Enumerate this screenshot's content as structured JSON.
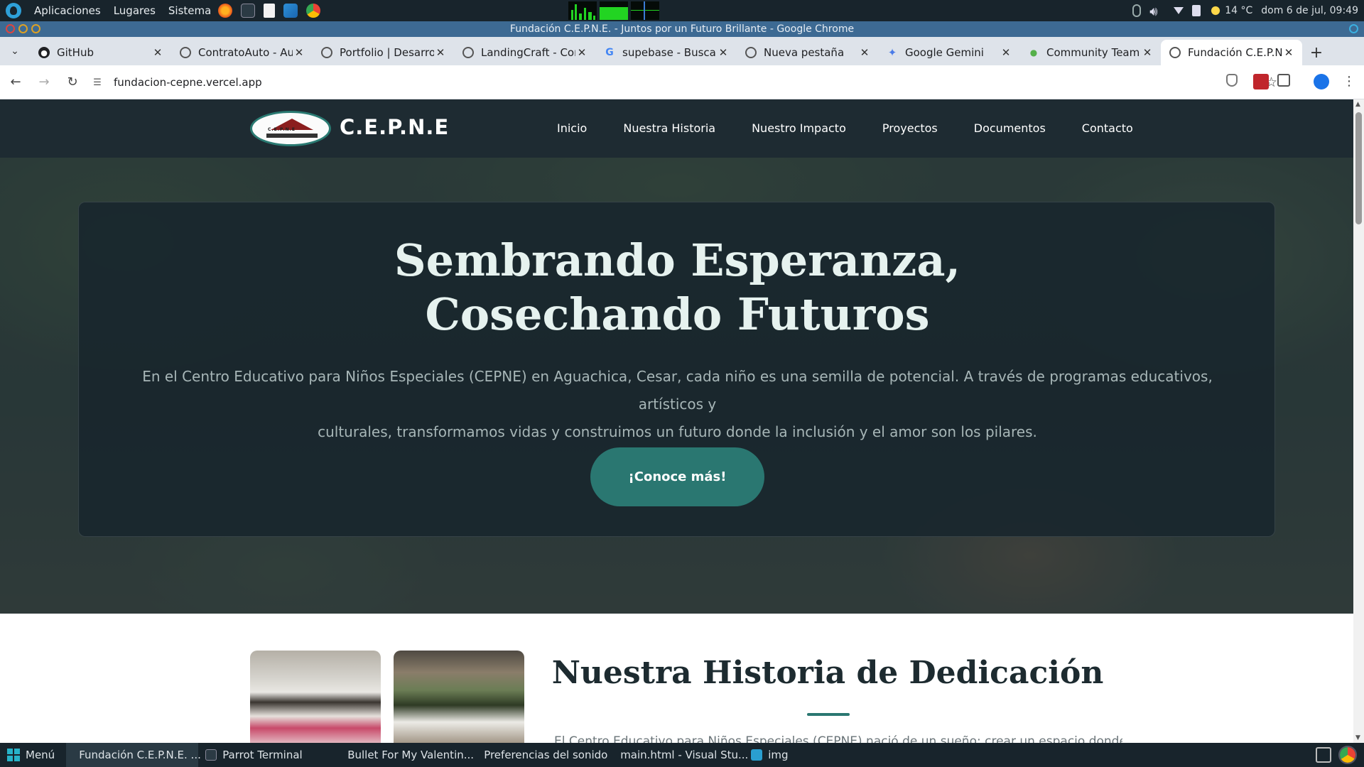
{
  "os_panel": {
    "menu": [
      "Aplicaciones",
      "Lugares",
      "Sistema"
    ],
    "weather": "14 °C",
    "datetime": "dom 6 de jul, 09:49"
  },
  "window": {
    "title": "Fundación C.E.P.N.E. - Juntos por un Futuro Brillante - Google Chrome"
  },
  "tabs": [
    {
      "label": "GitHub",
      "favicon": "github-icon",
      "active": false
    },
    {
      "label": "ContratoAuto - Aut",
      "favicon": "globe-icon",
      "active": false
    },
    {
      "label": "Portfolio | Desarrol",
      "favicon": "globe-icon",
      "active": false
    },
    {
      "label": "LandingCraft - Con",
      "favicon": "globe-icon",
      "active": false
    },
    {
      "label": "supebase - Buscar c",
      "favicon": "google-icon",
      "active": false
    },
    {
      "label": "Nueva pestaña",
      "favicon": "chrome-icon",
      "active": false
    },
    {
      "label": "Google Gemini",
      "favicon": "gemini-icon",
      "active": false
    },
    {
      "label": "Community Team",
      "favicon": "leaf-icon",
      "active": false
    },
    {
      "label": "Fundación C.E.P.N.",
      "favicon": "globe-icon",
      "active": true
    }
  ],
  "address": {
    "url": "fundacion-cepne.vercel.app"
  },
  "site": {
    "brand": "C.E.P.N.E",
    "logo_text": "C.E.P.N.E",
    "nav": [
      "Inicio",
      "Nuestra Historia",
      "Nuestro Impacto",
      "Proyectos",
      "Documentos",
      "Contacto"
    ],
    "hero": {
      "title_line1": "Sembrando Esperanza,",
      "title_line2": "Cosechando Futuros",
      "subtitle_line1": "En el Centro Educativo para Niños Especiales (CEPNE) en Aguachica, Cesar, cada niño es una semilla de potencial. A través de programas educativos, artísticos y",
      "subtitle_line2": "culturales, transformamos vidas y construimos un futuro donde la inclusión y el amor son los pilares.",
      "button": "¡Conoce más!"
    },
    "history": {
      "title": "Nuestra Historia de Dedicación",
      "paragraph": "El Centro Educativo para Niños Especiales (CEPNE) nació de un sueño: crear un espacio donde niños"
    }
  },
  "taskbar": {
    "start": "Menú",
    "items": [
      {
        "label": "Fundación C.E.P.N.E. ...",
        "icon": "chrome-icon"
      },
      {
        "label": "Parrot Terminal",
        "icon": "terminal-icon"
      },
      {
        "label": "Bullet For My Valentin...",
        "icon": "spotify-icon"
      },
      {
        "label": "Preferencias del sonido",
        "icon": "sound-icon"
      },
      {
        "label": "main.html - Visual Stu...",
        "icon": "vscode-icon"
      },
      {
        "label": "img",
        "icon": "folder-icon"
      }
    ]
  },
  "colors": {
    "accent": "#2a7771",
    "site_nav_bg": "#1e2b32",
    "title_bar": "#3d6a93"
  }
}
